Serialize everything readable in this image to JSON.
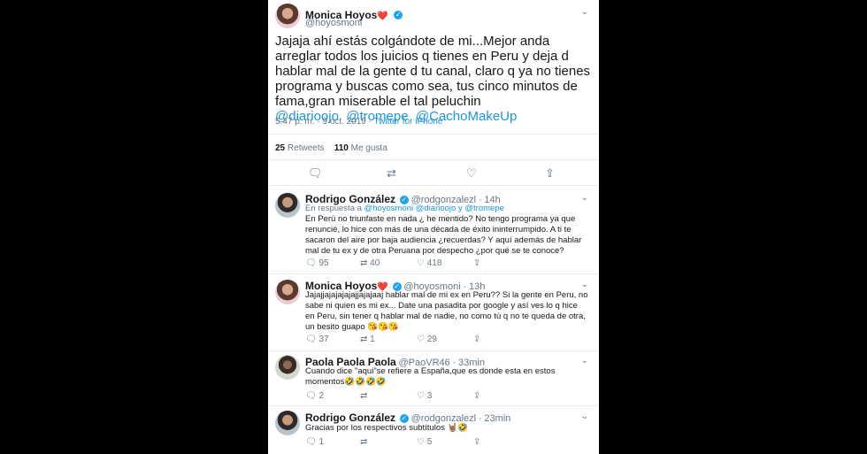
{
  "main_tweet": {
    "name": "Monica Hoyos",
    "name_emoji": "❤️",
    "handle": "@hoyosmoni",
    "text": "Jajaja ahí estás colgándote de mi...Mejor anda arreglar todos los juicios q tienes en Peru y deja d hablar mal de la gente d tu canal, claro q ya no tienes programa y buscas como sea, tus cinco minutos de fama,gran miserable el tal peluchin",
    "mentions": [
      "@diarioojo",
      "@tromepe",
      "@CachoMakeUp"
    ],
    "time": "5:47 p. m. · 9 oct. 2019",
    "source": "Twitter for iPhone",
    "retweets_count": "25",
    "retweets_label": "Retweets",
    "likes_count": "110",
    "likes_label": "Me gusta"
  },
  "replies": [
    {
      "name": "Rodrigo González",
      "handle": "@rodgonzalezl",
      "time": "14h",
      "reply_to_prefix": "En respuesta a",
      "reply_to": "@hoyosmoni @diarioojo y @tromepe",
      "text": "En Perú no triunfaste en nada ¿ he mentido? No tengo programa ya que renuncié, lo hice con más de una década de éxito ininterrumpido. A ti te sacaron del aire por baja audiencia ¿recuerdas? Y aquí además de hablar mal de tu ex y de otra Peruana por despecho ¿por qué se te conoce?",
      "replies": "95",
      "retweets": "40",
      "likes": "418"
    },
    {
      "name": "Monica Hoyos",
      "name_emoji": "❤️",
      "handle": "@hoyosmoni",
      "time": "13h",
      "text": "Jajajjajajajajajjajajaaj hablar mal de mi ex en Peru?? Si la gente en Peru, no sabe ni quien es mi ex... Date una pasadita por google y así ves lo q hice en Peru, sin tener q hablar mal de nadie, no como tú q no te queda de otra, un besito guapo 😘😘😘",
      "replies": "37",
      "retweets": "1",
      "likes": "29"
    },
    {
      "name": "Paola Paola Paola",
      "handle": "@PaoVR46",
      "time": "33min",
      "text": "Cuando dice \"aqui\"se refiere a España,que es donde esta en estos momentos🤣🤣🤣🤣",
      "replies": "2",
      "retweets": "",
      "likes": "3"
    },
    {
      "name": "Rodrigo González",
      "handle": "@rodgonzalezl",
      "time": "23min",
      "text": "Gracias por los respectivos subtítulos 🤘🏽🤣",
      "replies": "1",
      "retweets": "",
      "likes": "5"
    }
  ],
  "icons": {
    "reply": "reply-icon",
    "retweet": "retweet-icon",
    "like": "heart-icon",
    "share": "share-icon",
    "verified": "verified-badge-icon",
    "more": "chevron-down-icon"
  },
  "colors": {
    "link": "#1b95e0",
    "muted": "#657786",
    "verified": "#1da1f2"
  }
}
